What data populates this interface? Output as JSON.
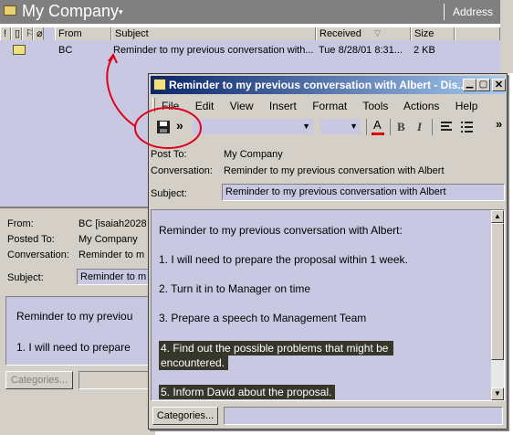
{
  "folder_bar": {
    "title": "My Company",
    "address_label": "Address"
  },
  "list": {
    "columns": [
      "!",
      "",
      "",
      "",
      "From",
      "Subject",
      "Received",
      "",
      "Size"
    ],
    "row": {
      "from": "BC",
      "subject": "Reminder to my previous conversation with...",
      "received": "Tue 8/28/01 8:31...",
      "size": "2 KB"
    }
  },
  "preview": {
    "from_label": "From:",
    "from_value": "BC [isaiah2028",
    "posted_label": "Posted To:",
    "posted_value": "My Company",
    "conv_label": "Conversation:",
    "conv_value": "Reminder to m",
    "subject_label": "Subject:",
    "subject_value": "Reminder to m",
    "body_line1": "Reminder to my previou",
    "body_line2": "1. I will need to prepare",
    "categories_label": "Categories..."
  },
  "window": {
    "title": "Reminder to my previous conversation with Albert - Dis...",
    "menu": [
      "File",
      "Edit",
      "View",
      "Insert",
      "Format",
      "Tools",
      "Actions",
      "Help"
    ],
    "posted_label": "Post To:",
    "posted_value": "My Company",
    "conv_label": "Conversation:",
    "conv_value": "Reminder to my previous conversation with Albert",
    "subject_label": "Subject:",
    "subject_value": "Reminder to my previous conversation with Albert",
    "body": [
      "Reminder to my previous conversation with Albert:",
      "1. I will need to prepare the proposal within 1 week.",
      "2. Turn it in to Manager on time",
      "3. Prepare a speech to Management Team",
      "4. Find out the possible problems that might be",
      "encountered.",
      "5. Inform David about the proposal."
    ],
    "categories_label": "Categories...",
    "bold_label": "B",
    "italic_label": "I",
    "font_color_label": "A",
    "more_label": "»"
  },
  "colors": {
    "title_bar": "#0a246a",
    "panel": "#c8c8e2",
    "annotation": "#e0001b"
  }
}
